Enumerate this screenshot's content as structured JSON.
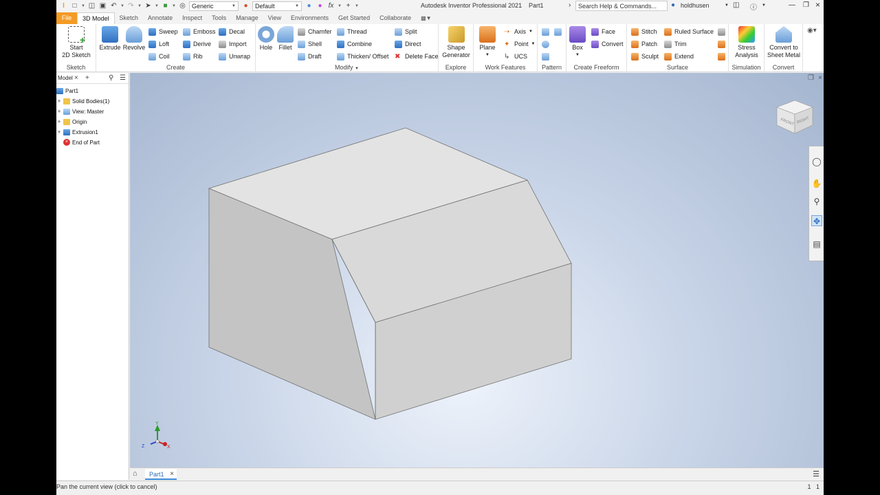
{
  "window": {
    "title": "Autodesk Inventor Professional 2021",
    "document": "Part1",
    "search_placeholder": "Search Help & Commands...",
    "user": "holdhusen",
    "appearance_combo": "Generic",
    "material_combo": "Default"
  },
  "tabs": [
    "File",
    "3D Model",
    "Sketch",
    "Annotate",
    "Inspect",
    "Tools",
    "Manage",
    "View",
    "Environments",
    "Get Started",
    "Collaborate"
  ],
  "ribbon": {
    "sketch": {
      "title": "Sketch",
      "start_line1": "Start",
      "start_line2": "2D Sketch"
    },
    "create": {
      "title": "Create",
      "extrude": "Extrude",
      "revolve": "Revolve",
      "sweep": "Sweep",
      "loft": "Loft",
      "coil": "Coil",
      "emboss": "Emboss",
      "derive": "Derive",
      "rib": "Rib",
      "decal": "Decal",
      "import": "Import",
      "unwrap": "Unwrap"
    },
    "modify": {
      "title": "Modify",
      "hole": "Hole",
      "fillet": "Fillet",
      "chamfer": "Chamfer",
      "shell": "Shell",
      "draft": "Draft",
      "thread": "Thread",
      "combine": "Combine",
      "thicken": "Thicken/ Offset",
      "split": "Split",
      "direct": "Direct",
      "delete_face": "Delete Face"
    },
    "explore": {
      "title": "Explore",
      "shape_line1": "Shape",
      "shape_line2": "Generator"
    },
    "work": {
      "title": "Work Features",
      "plane": "Plane",
      "axis": "Axis",
      "point": "Point",
      "ucs": "UCS"
    },
    "pattern": {
      "title": "Pattern"
    },
    "freeform": {
      "title": "Create Freeform",
      "box": "Box",
      "face": "Face",
      "convert": "Convert"
    },
    "surface": {
      "title": "Surface",
      "stitch": "Stitch",
      "patch": "Patch",
      "sculpt": "Sculpt",
      "ruled": "Ruled Surface",
      "trim": "Trim",
      "extend": "Extend"
    },
    "simulation": {
      "title": "Simulation",
      "stress_line1": "Stress",
      "stress_line2": "Analysis"
    },
    "convert": {
      "title": "Convert",
      "sheet_line1": "Convert to",
      "sheet_line2": "Sheet Metal"
    }
  },
  "browser": {
    "tab": "Model",
    "items": [
      {
        "label": "Part1",
        "icon": "part-icon",
        "expander": ""
      },
      {
        "label": "Solid Bodies(1)",
        "icon": "folder-icon",
        "expander": "+"
      },
      {
        "label": "View: Master",
        "icon": "view-icon",
        "expander": "+"
      },
      {
        "label": "Origin",
        "icon": "folder-icon",
        "expander": "+"
      },
      {
        "label": "Extrusion1",
        "icon": "extrusion-icon",
        "expander": "+"
      },
      {
        "label": "End of Part",
        "icon": "end-of-part-icon",
        "expander": ""
      }
    ]
  },
  "viewcube": {
    "front": "FRONT",
    "right": "RIGHT"
  },
  "triad": {
    "x": "X",
    "y": "Y",
    "z": "Z"
  },
  "doc_tab": "Part1",
  "status": {
    "message": "Pan the current view (click to cancel)",
    "count1": "1",
    "count2": "1"
  },
  "colors": {
    "file_tab": "#f49b25",
    "accent": "#3c8ad8",
    "model_face_top": "#e3e3e3",
    "model_face_front": "#d0d0d0",
    "model_face_left": "#c4c4c4"
  }
}
